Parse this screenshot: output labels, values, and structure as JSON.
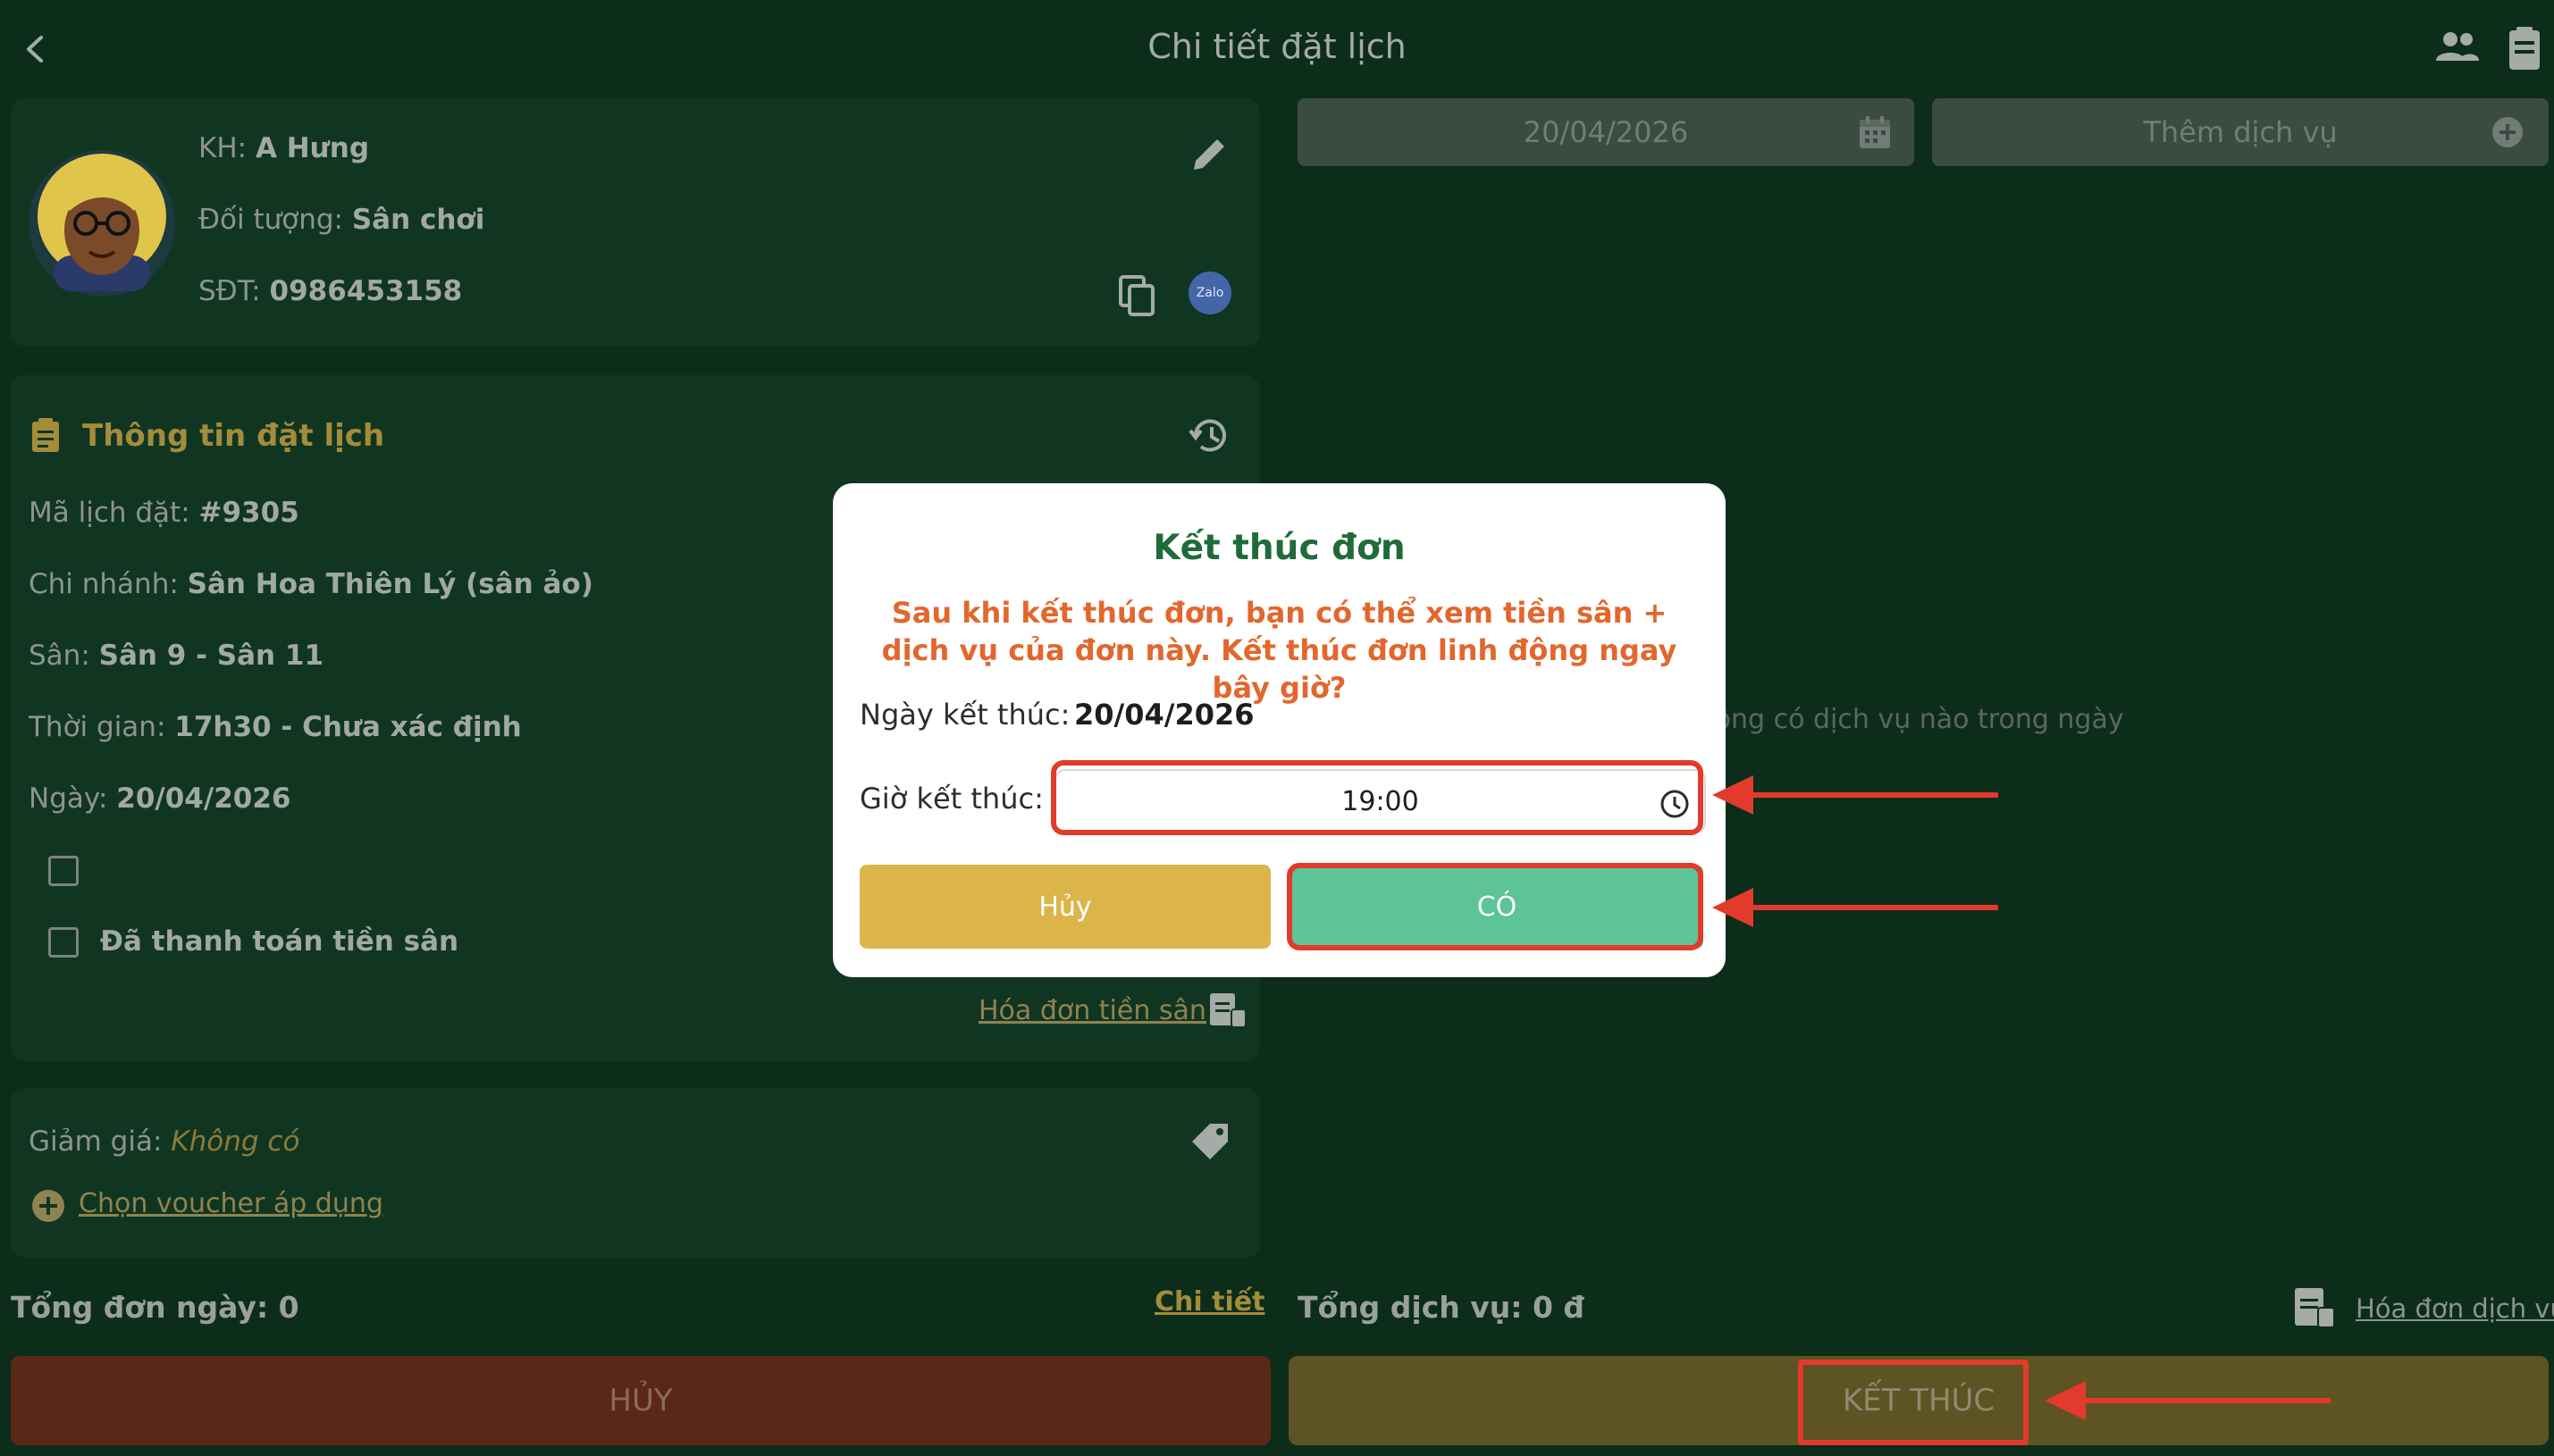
{
  "header": {
    "title": "Chi tiết đặt lịch"
  },
  "customer": {
    "name_label": "KH:",
    "name_value": "A Hưng",
    "type_label": "Đối tượng:",
    "type_value": "Sân chơi",
    "phone_label": "SĐT:",
    "phone_value": "0986453158",
    "zalo_label": "Zalo"
  },
  "booking": {
    "section_title": "Thông tin đặt lịch",
    "code_label": "Mã lịch đặt:",
    "code_value": "#9305",
    "branch_label": "Chi nhánh:",
    "branch_value": "Sân Hoa Thiên Lý (sân ảo)",
    "court_label": "Sân:",
    "court_value": "Sân 9 - Sân 11",
    "time_label": "Thời gian:",
    "time_value": "17h30 - Chưa xác định",
    "date_label": "Ngày:",
    "date_value": "20/04/2026",
    "paid_label": "Đã thanh toán tiền sân",
    "invoice_link": "Hóa đơn tiền sân"
  },
  "discount": {
    "label": "Giảm giá:",
    "value": "Không có",
    "voucher_link": "Chọn voucher áp dụng"
  },
  "totals": {
    "day_total": "Tổng đơn ngày: 0",
    "detail_link": "Chi tiết",
    "service_total": "Tổng dịch vụ: 0 đ",
    "service_invoice_link": "Hóa đơn dịch vụ"
  },
  "right_panel": {
    "date_value": "20/04/2026",
    "add_service": "Thêm dịch vụ",
    "empty_text": "Không có dịch vụ nào trong ngày"
  },
  "bottom": {
    "cancel": "HỦY",
    "finish": "KẾT THÚC"
  },
  "modal": {
    "title": "Kết thúc đơn",
    "message": "Sau khi kết thúc đơn, bạn có thể xem tiền sân + dịch vụ của đơn này. Kết thúc đơn linh động ngay bây giờ?",
    "end_date_label": "Ngày kết thúc:",
    "end_date_value": "20/04/2026",
    "end_time_label": "Giờ kết thúc:",
    "end_time_value": "19:00",
    "cancel_button": "Hủy",
    "confirm_button": "CÓ"
  },
  "colors": {
    "background": "#0c2d1a",
    "card": "#103622",
    "accent_gold": "#a48c3a",
    "modal_title": "#1f6b3a",
    "modal_message": "#e2672e",
    "cancel_yellow": "#dcb54a",
    "confirm_green": "#5cc497",
    "bottom_cancel": "#5b2818",
    "bottom_finish": "#5e5322",
    "annotation_red": "#e23a2c"
  }
}
